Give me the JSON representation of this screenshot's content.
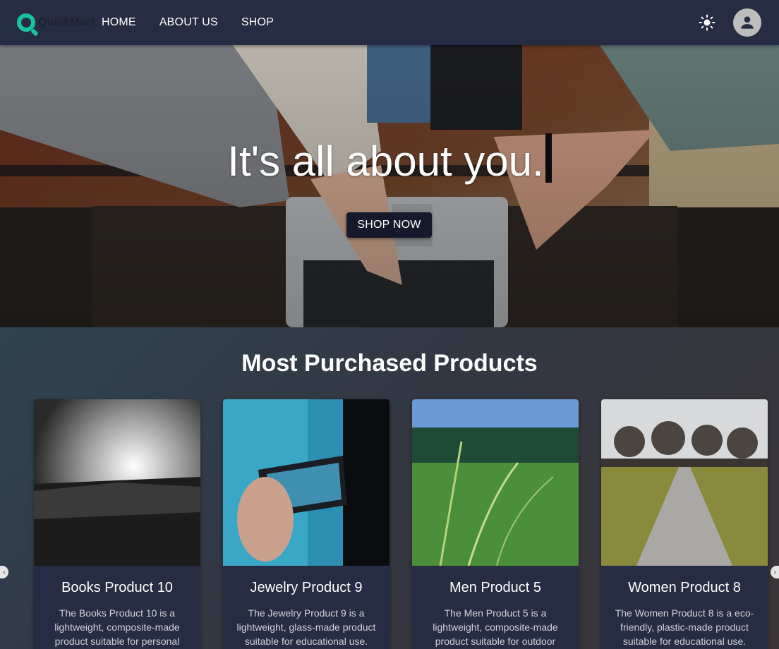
{
  "brand": {
    "name": "QuickMart",
    "accent": "#16c2a0"
  },
  "nav": {
    "links": [
      "HOME",
      "ABOUT US",
      "SHOP"
    ]
  },
  "hero": {
    "title": "It's all about you.",
    "cta": "SHOP NOW"
  },
  "products": {
    "heading": "Most Purchased Products",
    "items": [
      {
        "name": "Books Product 10",
        "description": "The Books Product 10 is a lightweight, composite-made product suitable for personal"
      },
      {
        "name": "Jewelry Product 9",
        "description": "The Jewelry Product 9 is a lightweight, glass-made product suitable for educational use."
      },
      {
        "name": "Men Product 5",
        "description": "The Men Product 5 is a lightweight, composite-made product suitable for outdoor"
      },
      {
        "name": "Women Product 8",
        "description": "The Women Product 8 is a eco-friendly, plastic-made product suitable for educational use."
      }
    ]
  },
  "colors": {
    "navbar": "#262c43",
    "button": "#15192b",
    "card": "#262c43"
  }
}
